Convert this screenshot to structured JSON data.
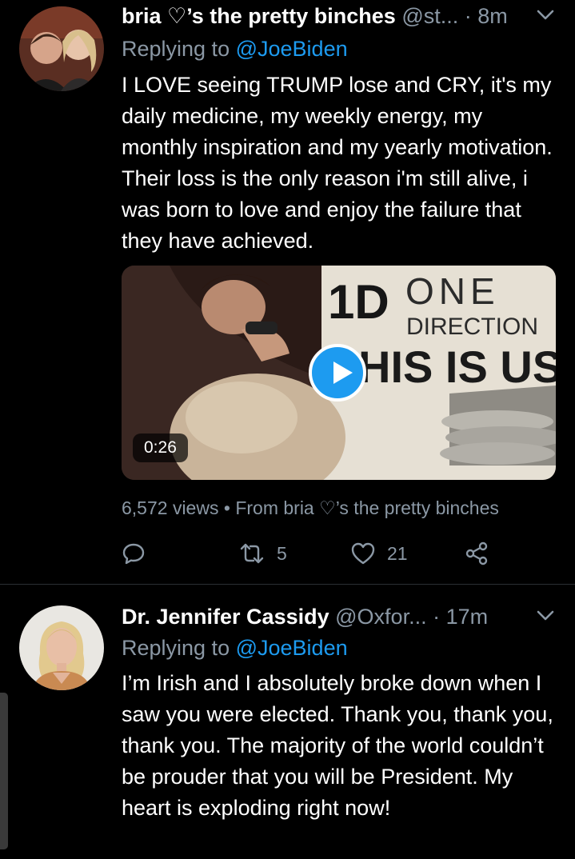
{
  "tweets": [
    {
      "name": "bria ♡’s the pretty binches",
      "handle": "@st...",
      "time": "· 8m",
      "replying_prefix": "Replying to",
      "replying_to": "@JoeBiden",
      "text": "I LOVE seeing TRUMP lose and CRY, it's my daily medicine, my weekly energy, my monthly inspiration and my yearly motivation. Their loss is the only reason i'm still alive, i was born to love and enjoy the failure that they have achieved.",
      "video": {
        "duration": "0:26",
        "overlay_text": [
          "1D",
          "ONE",
          "DIRECTION",
          "HIS IS US"
        ]
      },
      "views": "6,572 views",
      "separator": "•",
      "from": "From bria ♡’s the pretty binches",
      "retweets": "5",
      "likes": "21"
    },
    {
      "name": "Dr. Jennifer Cassidy",
      "handle": "@Oxfor...",
      "time": "· 17m",
      "replying_prefix": "Replying to",
      "replying_to": "@JoeBiden",
      "text": "I’m Irish and I absolutely broke down when I saw you were elected. Thank you, thank you, thank you. The majority of the world couldn’t be prouder that you will be President. My heart is exploding right now!"
    }
  ],
  "colors": {
    "background": "#000000",
    "text": "#ffffff",
    "muted": "#8b98a5",
    "accent": "#1d9bf0"
  },
  "icons": [
    "chevron-down-icon",
    "reply-icon",
    "retweet-icon",
    "like-icon",
    "share-icon",
    "play-icon"
  ]
}
